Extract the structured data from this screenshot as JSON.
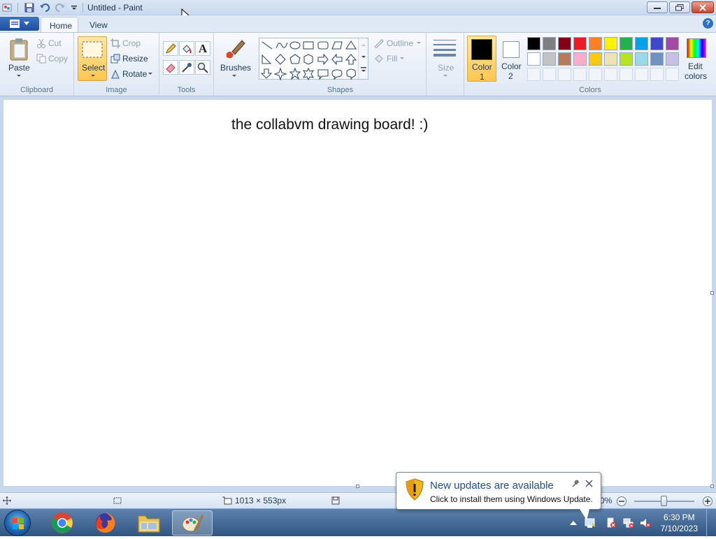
{
  "window": {
    "title": "Untitled - Paint",
    "tabs": [
      {
        "label": "Home"
      },
      {
        "label": "View"
      }
    ]
  },
  "ribbon": {
    "clipboard": {
      "group_label": "Clipboard",
      "paste": "Paste",
      "cut": "Cut",
      "copy": "Copy"
    },
    "image": {
      "group_label": "Image",
      "select": "Select",
      "crop": "Crop",
      "resize": "Resize",
      "rotate": "Rotate"
    },
    "tools": {
      "group_label": "Tools"
    },
    "brushes": {
      "label": "Brushes"
    },
    "shapes": {
      "group_label": "Shapes",
      "outline": "Outline",
      "fill": "Fill"
    },
    "size": {
      "label": "Size"
    },
    "colors": {
      "group_label": "Colors",
      "color1": "Color\n1",
      "color1_line1": "Color",
      "color1_line2": "1",
      "color2_line1": "Color",
      "color2_line2": "2",
      "edit_line1": "Edit",
      "edit_line2": "colors",
      "color1_value": "#000000",
      "color2_value": "#ffffff",
      "palette_row1": [
        "#000000",
        "#7f7f7f",
        "#880015",
        "#ed1c24",
        "#ff7f27",
        "#fff200",
        "#22b14c",
        "#00a2e8",
        "#3f48cc",
        "#a349a4"
      ],
      "palette_row2": [
        "#ffffff",
        "#c3c3c3",
        "#b97a57",
        "#ffaec9",
        "#ffc90e",
        "#efe4b0",
        "#b5e61d",
        "#99d9ea",
        "#7092be",
        "#c8bfe7"
      ]
    }
  },
  "canvas": {
    "text": "the collabvm drawing board! :)"
  },
  "status": {
    "dimensions": "1013 × 553px",
    "zoom": "0%"
  },
  "notification": {
    "title": "New updates are available",
    "body": "Click to install them using Windows Update."
  },
  "taskbar": {
    "time": "6:30 PM",
    "date": "7/10/2023"
  }
}
